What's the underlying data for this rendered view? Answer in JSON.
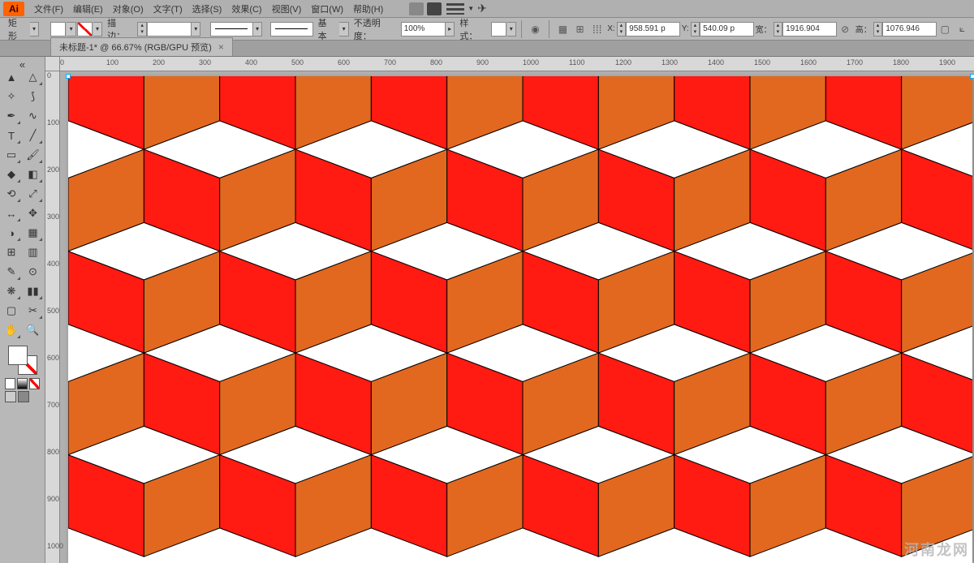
{
  "menubar": {
    "items": [
      "文件(F)",
      "编辑(E)",
      "对象(O)",
      "文字(T)",
      "选择(S)",
      "效果(C)",
      "视图(V)",
      "窗口(W)",
      "帮助(H)"
    ]
  },
  "controlbar": {
    "shape": "矩形",
    "stroke_label": "描边：",
    "stroke_weight": "",
    "basic_label": "基本",
    "opacity_label": "不透明度：",
    "opacity_value": "100%",
    "style_label": "样式：",
    "x_label": "X:",
    "x_value": "958.591 p",
    "y_label": "Y:",
    "y_value": "540.09 p",
    "w_label": "宽：",
    "w_value": "1916.904",
    "h_label": "高：",
    "h_value": "1076.946"
  },
  "tab": {
    "title": "未标题-1* @ 66.67% (RGB/GPU 预览)"
  },
  "ruler_h": [
    "0",
    "100",
    "200",
    "300",
    "400",
    "500",
    "600",
    "700",
    "800",
    "900",
    "1000",
    "1100",
    "1200",
    "1300",
    "1400",
    "1500",
    "1600",
    "1700",
    "1800",
    "1900"
  ],
  "ruler_v": [
    "0",
    "100",
    "200",
    "300",
    "400",
    "500",
    "600",
    "700",
    "800",
    "900",
    "1000"
  ],
  "pattern": {
    "color_left": "#ff1a12",
    "color_right": "#e2681f",
    "rows": 5,
    "cols": 6
  },
  "watermark": "河南龙网"
}
